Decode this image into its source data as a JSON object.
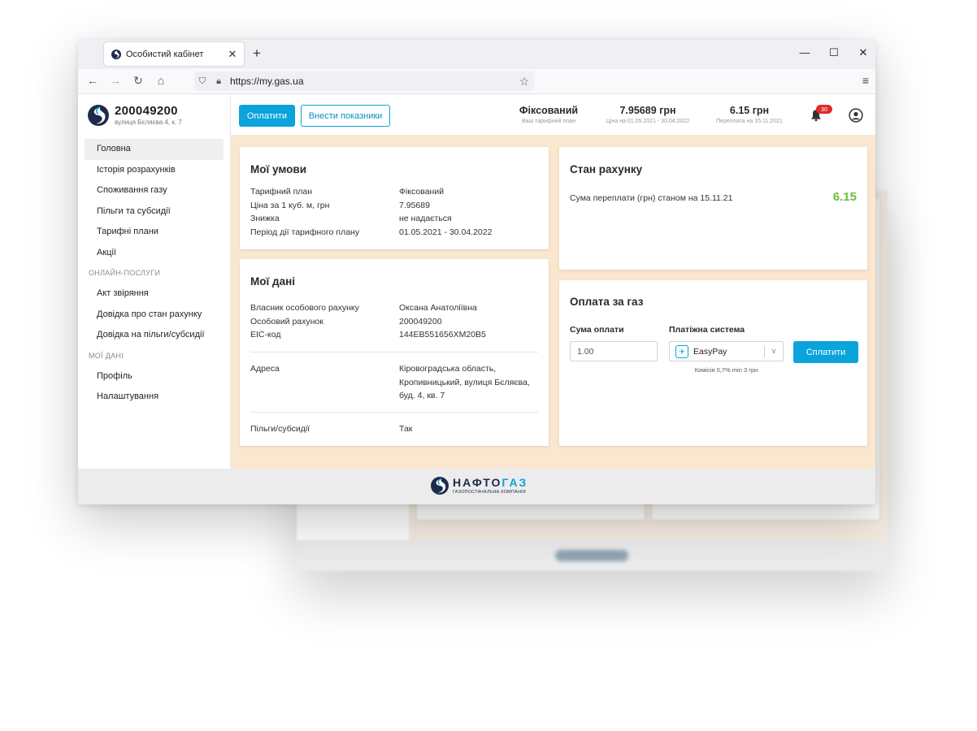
{
  "browser": {
    "tab_title": "Особистий кабінет",
    "tab_close": "✕",
    "new_tab": "+",
    "url": "https://my.gas.ua"
  },
  "account": {
    "number": "200049200",
    "address": "вулиця Бєляєва 4, к. 7"
  },
  "sidebar": {
    "items_main": [
      "Головна",
      "Історія розрахунків",
      "Споживання газу",
      "Пільги та субсидії",
      "Тарифні плани",
      "Акції"
    ],
    "section_online": "ОНЛАЙН-ПОСЛУГИ",
    "items_online": [
      "Акт звіряння",
      "Довідка про стан рахунку",
      "Довідка на пільги/субсидії"
    ],
    "section_data": "МОЇ ДАНІ",
    "items_data": [
      "Профіль",
      "Налаштування"
    ]
  },
  "topbar": {
    "pay_label": "Оплатити",
    "meter_label": "Внести показники",
    "tariff_value": "Фіксований",
    "tariff_caption": "Ваш тарифний план",
    "price_value": "7.95689 грн",
    "price_caption": "Ціна на 01.05.2021 - 30.04.2022",
    "overpay_value": "6.15 грн",
    "overpay_caption": "Переплата на 15.11.2021",
    "notifications": "30"
  },
  "conditions": {
    "title": "Мої умови",
    "rows": [
      {
        "k": "Тарифний план",
        "v": "Фіксований"
      },
      {
        "k": "Ціна за 1 куб. м, грн",
        "v": "7.95689"
      },
      {
        "k": "Знижка",
        "v": "не надається"
      },
      {
        "k": "Період дії тарифного плану",
        "v": "01.05.2021 - 30.04.2022"
      }
    ]
  },
  "mydata": {
    "title": "Мої дані",
    "owner_label": "Власник особового рахунку",
    "owner_value": "Оксана Анатоліївна",
    "account_label": "Особовий рахунок",
    "account_value": "200049200",
    "eic_label": "EIC-код",
    "eic_value": "144EB551656XM20B5",
    "address_label": "Адреса",
    "address_lines": [
      "Кіровоградська область,",
      "Кропивницький, вулиця Бєляєва,",
      "буд. 4, кв. 7"
    ],
    "benefits_label": "Пільги/субсидії",
    "benefits_value": "Так"
  },
  "balance": {
    "title": "Стан рахунку",
    "label": "Сума переплати (грн) станом на 15.11.21",
    "value": "6.15",
    "value_color": "#6bbf3c"
  },
  "payment": {
    "title": "Оплата за газ",
    "amount_label": "Сума оплати",
    "amount_value": "1.00",
    "system_label": "Платіжна система",
    "system_value": "EasyPay",
    "commission": "Комісія 0,7% min 3 грн",
    "pay_button": "Сплатити"
  },
  "footer": {
    "brand": "НАФТОГАЗ",
    "brand_part1": "НАФТО",
    "brand_part2": "ГАЗ",
    "tagline": "ГАЗОПОСТАЧАЛЬНА КОМПАНІЯ"
  },
  "colors": {
    "accent": "#0aa3dc",
    "content_bg": "#fbe7cf",
    "positive": "#6bbf3c",
    "badge": "#e02a2a"
  }
}
